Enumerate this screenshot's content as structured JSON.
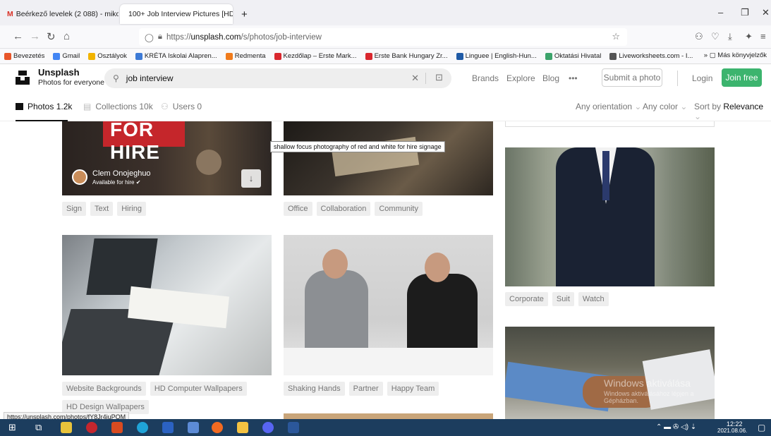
{
  "browser": {
    "tabs": [
      {
        "title": "Beérkező levelek (2 088) - miko",
        "close": "×"
      },
      {
        "title": "100+ Job Interview Pictures [HD",
        "close": "×"
      }
    ],
    "new_tab": "+",
    "url_prefix": "https://",
    "url_host": "unsplash.com",
    "url_path": "/s/photos/job-interview",
    "bookmarks": [
      {
        "label": "Bevezetés",
        "color": "#e8562a"
      },
      {
        "label": "Gmail",
        "color": "#4285f4"
      },
      {
        "label": "Osztályok",
        "color": "#f2b400"
      },
      {
        "label": "KRÉTA Iskolai Alapren...",
        "color": "#3d7ad6"
      },
      {
        "label": "Redmenta",
        "color": "#f07b1c"
      },
      {
        "label": "Kezdőlap – Erste Mark...",
        "color": "#d9272e"
      },
      {
        "label": "Erste Bank Hungary Zr...",
        "color": "#d9272e"
      },
      {
        "label": "Linguee | English-Hun...",
        "color": "#1f5aa6"
      },
      {
        "label": "Oktatási Hivatal",
        "color": "#3ca36b"
      },
      {
        "label": "Liveworksheets.com - I...",
        "color": "#555555"
      }
    ],
    "bookmarks_more": "Más könyvjelzők",
    "status_url": "https://unsplash.com/photos/fY8Jr4iuPQM"
  },
  "header": {
    "brand": "Unsplash",
    "tagline": "Photos for everyone",
    "search_value": "job interview",
    "links": [
      "Brands",
      "Explore",
      "Blog",
      "•••"
    ],
    "submit": "Submit a photo",
    "login": "Login",
    "join": "Join free"
  },
  "subnav": {
    "photos": "Photos 1.2k",
    "collections": "Collections 10k",
    "users": "Users 0",
    "orientation": "Any orientation",
    "color": "Any color",
    "sort_prefix": "Sort by",
    "sort_value": "Relevance"
  },
  "content": {
    "tooltip": "shallow focus photography of red and white for hire signage",
    "author_name": "Clem Onojeghuo",
    "author_status": "Available for hire",
    "sign_text": "FOR HIRE",
    "tags_col1_row1": [
      "Sign",
      "Text",
      "Hiring"
    ],
    "tags_col2_row1": [
      "Office",
      "Collaboration",
      "Community"
    ],
    "tags_col3_row1": [
      "Corporate",
      "Suit",
      "Watch"
    ],
    "tags_col1_row2": [
      "Website Backgrounds",
      "HD Computer Wallpapers",
      "HD Design Wallpapers"
    ],
    "tags_col2_row2": [
      "Shaking Hands",
      "Partner",
      "Happy Team"
    ],
    "watermark": "Windows aktiválása",
    "watermark_sub": "Windows aktiválásához lépjen a Gépházban."
  },
  "taskbar": {
    "time": "12:22",
    "date": "2021.08.06."
  }
}
